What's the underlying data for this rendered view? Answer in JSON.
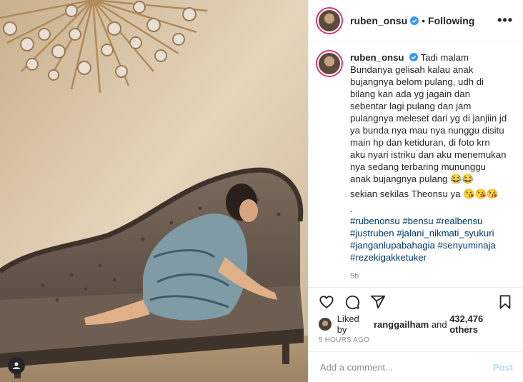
{
  "header": {
    "username": "ruben_onsu",
    "separator": "•",
    "follow_status": "Following",
    "more_label": "•••"
  },
  "caption": {
    "username": "ruben_onsu",
    "text": "Tadi malam Bundanya gelisah kalau anak bujangnya belom pulang, udh di bilang kan ada yg jagain dan sebentar lagi pulang dan jam pulangnya meleset dari yg di janjiin jd ya bunda nya mau nya nunggu disitu main hp dan ketiduran, di foto krn aku nyari istriku dan aku menemukan nya sedang terbaring mununggu anak bujangnya pulang 😂😂",
    "line2": "sekian sekilas Theonsu ya 😘😘😘",
    "line3": ".",
    "hashtags": "#rubenonsu #bensu #realbensu #justruben #jalani_nikmati_syukuri #janganlupabahagia #senyuminaja #rezekigakketuker",
    "time": "5h"
  },
  "likes": {
    "prefix": "Liked by",
    "user": "ranggailham",
    "middle": "and",
    "count": "432,476 others"
  },
  "posted": "5 HOURS AGO",
  "comment": {
    "placeholder": "Add a comment...",
    "post_label": "Post"
  },
  "colors": {
    "link": "#00376b",
    "post_disabled": "#b2dffc",
    "verified": "#3897f0",
    "muted": "#8e8e8e"
  }
}
